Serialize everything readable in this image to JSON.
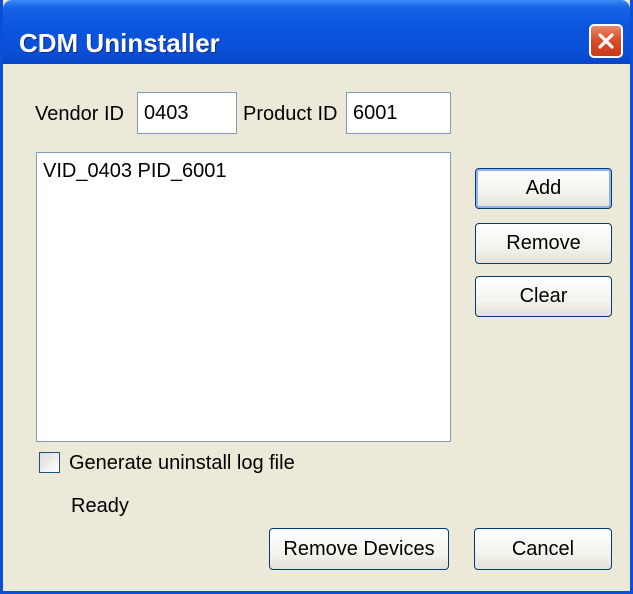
{
  "window": {
    "title": "CDM Uninstaller"
  },
  "fields": {
    "vendor_label": "Vendor ID",
    "vendor_value": "0403",
    "product_label": "Product ID",
    "product_value": "6001"
  },
  "device_list": {
    "items": [
      "VID_0403 PID_6001"
    ]
  },
  "buttons": {
    "add": "Add",
    "remove": "Remove",
    "clear": "Clear",
    "remove_devices": "Remove Devices",
    "cancel": "Cancel"
  },
  "log_option": {
    "label": "Generate uninstall log file",
    "checked": false
  },
  "status": {
    "text": "Ready"
  },
  "icons": {
    "close": "close-icon"
  },
  "colors": {
    "title_bar": "#0a50d6",
    "dialog_background": "#ece9d8",
    "close_button": "#d9502a"
  }
}
